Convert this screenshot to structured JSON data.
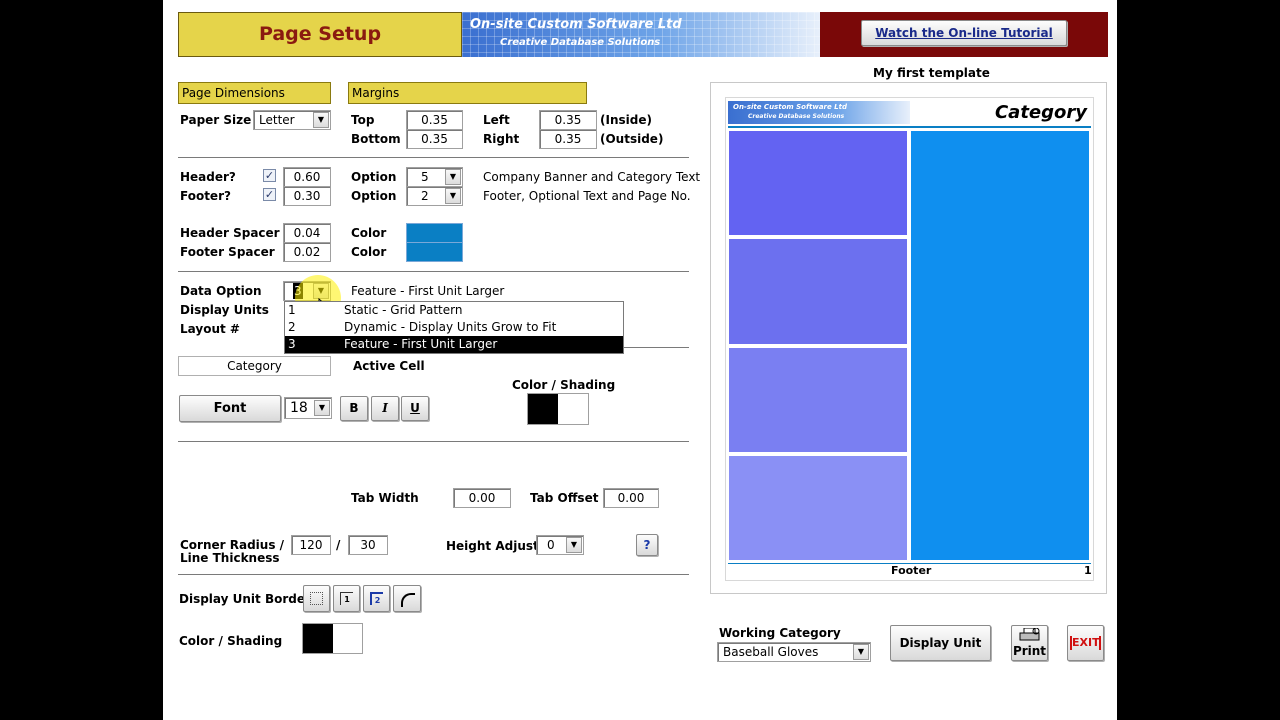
{
  "header": {
    "title": "Page Setup",
    "banner_company": "On-site Custom Software Ltd",
    "banner_tagline": "Creative Database Solutions",
    "tutorial_button": "Watch the On-line Tutorial"
  },
  "template_name": "My first template",
  "page_dimensions": {
    "section_label": "Page Dimensions",
    "paper_size_label": "Paper Size",
    "paper_size_value": "Letter"
  },
  "margins": {
    "section_label": "Margins",
    "top_label": "Top",
    "top_value": "0.35",
    "bottom_label": "Bottom",
    "bottom_value": "0.35",
    "left_label": "Left",
    "left_value": "0.35",
    "left_note": "(Inside)",
    "right_label": "Right",
    "right_value": "0.35",
    "right_note": "(Outside)"
  },
  "header_footer": {
    "header_label": "Header?",
    "header_checked": true,
    "header_value": "0.60",
    "footer_label": "Footer?",
    "footer_checked": true,
    "footer_value": "0.30",
    "option_label": "Option",
    "header_option": "5",
    "footer_option": "2",
    "header_desc": "Company Banner and Category Text",
    "footer_desc": "Footer, Optional Text and Page No."
  },
  "spacers": {
    "header_spacer_label": "Header Spacer",
    "header_spacer_value": "0.04",
    "footer_spacer_label": "Footer Spacer",
    "footer_spacer_value": "0.02",
    "color_label": "Color",
    "header_color": "#0a7fc4",
    "footer_color": "#0a7fc4"
  },
  "data_option": {
    "label": "Data Option",
    "value": "3",
    "desc": "Feature - First Unit Larger",
    "display_units_label": "Display Units",
    "layout_label": "Layout #",
    "dropdown_options": [
      {
        "num": "1",
        "text": "Static - Grid Pattern"
      },
      {
        "num": "2",
        "text": "Dynamic - Display Units Grow to Fit"
      },
      {
        "num": "3",
        "text": "Feature - First Unit Larger"
      }
    ]
  },
  "active_cell": {
    "category_field": "Category",
    "active_cell_label": "Active Cell",
    "color_shading_label": "Color / Shading",
    "font_button": "Font",
    "font_size": "18",
    "bold": "B",
    "italic": "I",
    "underline": "U"
  },
  "tabs": {
    "tab_width_label": "Tab Width",
    "tab_width_value": "0.00",
    "tab_offset_label": "Tab Offset",
    "tab_offset_value": "0.00"
  },
  "corners": {
    "corner_label_line1": "Corner Radius /",
    "corner_label_line2": "Line Thickness",
    "corner_radius": "120",
    "slash": "/",
    "line_thickness": "30",
    "height_adjust_label": "Height Adjust",
    "height_adjust_value": "0",
    "help": "?"
  },
  "borders": {
    "display_unit_borders_label": "Display Unit Borders",
    "color_shading_label": "Color / Shading"
  },
  "preview": {
    "banner_company": "On-site Custom Software Ltd",
    "banner_tagline": "Creative Database Solutions",
    "category": "Category",
    "footer": "Footer",
    "page_number": "1",
    "feature_color": "#0f8fef"
  },
  "bottom_bar": {
    "working_category_label": "Working Category",
    "working_category_value": "Baseball Gloves",
    "display_unit_button": "Display Unit",
    "print_button": "Print",
    "exit_button": "EXIT"
  }
}
